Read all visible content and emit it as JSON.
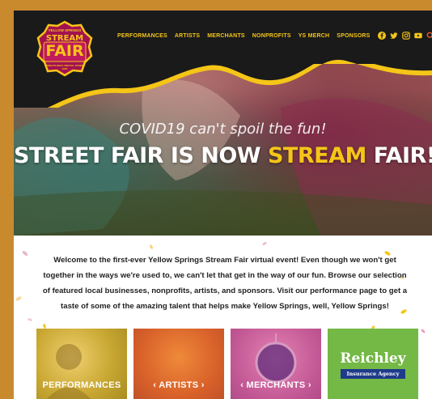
{
  "logo": {
    "top_text": "YELLOW SPRINGS",
    "line1": "STREAM",
    "line2": "FAIR",
    "bottom_text": "WORLD'S BEST VIRTUAL STREET FAIR"
  },
  "nav": {
    "items": [
      "PERFORMANCES",
      "ARTISTS",
      "MERCHANTS",
      "NONPROFITS",
      "YS MERCH",
      "SPONSORS"
    ],
    "social_icons": [
      "facebook-icon",
      "twitter-icon",
      "instagram-icon",
      "youtube-icon"
    ],
    "search_icon": "search-icon"
  },
  "hero": {
    "subtitle": "COVID19 can't spoil the fun!",
    "title_part1": "STREET FAIR IS NOW ",
    "title_accent": "STREAM",
    "title_part2": " FAIR!"
  },
  "intro": {
    "text": "Welcome to the first-ever Yellow Springs Stream Fair virtual event! Even though we won't get together in the ways we're used to, we can't let that get in the way of our fun. Browse our selection of featured local businesses, nonprofits, artists, and sponsors. Visit our performance page to get a taste of some of the amazing talent that helps make Yellow Springs, well, Yellow Springs!"
  },
  "tiles": [
    {
      "label": "PERFORMANCES"
    },
    {
      "label": "‹   ARTISTS   ›"
    },
    {
      "label": "‹ MERCHANTS ›"
    },
    {
      "title": "Reichley",
      "subtitle": "Insurance Agency"
    }
  ],
  "colors": {
    "accent_yellow": "#f5c518",
    "topbar": "#1a1a1a",
    "outer_border": "#c98a2e"
  }
}
